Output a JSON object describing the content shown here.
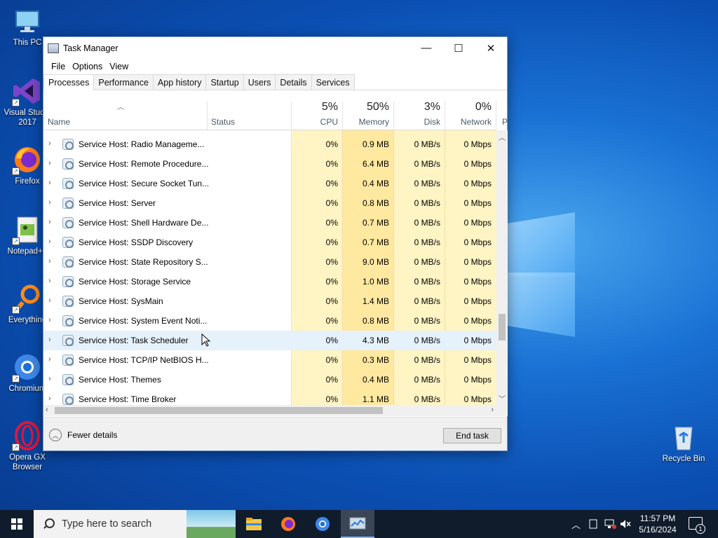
{
  "desktop": {
    "icons": [
      {
        "label": "This PC"
      },
      {
        "label": "Visual Studio 2017"
      },
      {
        "label": "Firefox"
      },
      {
        "label": "Notepad++"
      },
      {
        "label": "Everything"
      },
      {
        "label": "Chromium"
      },
      {
        "label": "Opera GX Browser"
      },
      {
        "label": "Recycle Bin"
      }
    ]
  },
  "window": {
    "title": "Task Manager",
    "menu": [
      "File",
      "Options",
      "View"
    ],
    "tabs": [
      "Processes",
      "Performance",
      "App history",
      "Startup",
      "Users",
      "Details",
      "Services"
    ],
    "active_tab": "Processes",
    "columns": {
      "name": "Name",
      "status": "Status",
      "cpu": {
        "pct": "5%",
        "label": "CPU"
      },
      "memory": {
        "pct": "50%",
        "label": "Memory"
      },
      "disk": {
        "pct": "3%",
        "label": "Disk"
      },
      "network": {
        "pct": "0%",
        "label": "Network"
      },
      "power": "P"
    },
    "rows": [
      {
        "name": "Service Host: Radio Manageme...",
        "cpu": "0%",
        "memory": "0.9 MB",
        "disk": "0 MB/s",
        "network": "0 Mbps"
      },
      {
        "name": "Service Host: Remote Procedure...",
        "cpu": "0%",
        "memory": "6.4 MB",
        "disk": "0 MB/s",
        "network": "0 Mbps"
      },
      {
        "name": "Service Host: Secure Socket Tun...",
        "cpu": "0%",
        "memory": "0.4 MB",
        "disk": "0 MB/s",
        "network": "0 Mbps"
      },
      {
        "name": "Service Host: Server",
        "cpu": "0%",
        "memory": "0.8 MB",
        "disk": "0 MB/s",
        "network": "0 Mbps"
      },
      {
        "name": "Service Host: Shell Hardware De...",
        "cpu": "0%",
        "memory": "0.7 MB",
        "disk": "0 MB/s",
        "network": "0 Mbps"
      },
      {
        "name": "Service Host: SSDP Discovery",
        "cpu": "0%",
        "memory": "0.7 MB",
        "disk": "0 MB/s",
        "network": "0 Mbps"
      },
      {
        "name": "Service Host: State Repository S...",
        "cpu": "0%",
        "memory": "9.0 MB",
        "disk": "0 MB/s",
        "network": "0 Mbps"
      },
      {
        "name": "Service Host: Storage Service",
        "cpu": "0%",
        "memory": "1.0 MB",
        "disk": "0 MB/s",
        "network": "0 Mbps"
      },
      {
        "name": "Service Host: SysMain",
        "cpu": "0%",
        "memory": "1.4 MB",
        "disk": "0 MB/s",
        "network": "0 Mbps"
      },
      {
        "name": "Service Host: System Event Noti...",
        "cpu": "0%",
        "memory": "0.8 MB",
        "disk": "0 MB/s",
        "network": "0 Mbps"
      },
      {
        "name": "Service Host: Task Scheduler",
        "cpu": "0%",
        "memory": "4.3 MB",
        "disk": "0 MB/s",
        "network": "0 Mbps"
      },
      {
        "name": "Service Host: TCP/IP NetBIOS H...",
        "cpu": "0%",
        "memory": "0.3 MB",
        "disk": "0 MB/s",
        "network": "0 Mbps"
      },
      {
        "name": "Service Host: Themes",
        "cpu": "0%",
        "memory": "0.4 MB",
        "disk": "0 MB/s",
        "network": "0 Mbps"
      },
      {
        "name": "Service Host: Time Broker",
        "cpu": "0%",
        "memory": "1.1 MB",
        "disk": "0 MB/s",
        "network": "0 Mbps"
      }
    ],
    "hovered_row": "Service Host: Task Scheduler",
    "footer": {
      "fewer_details": "Fewer details",
      "end_task": "End task"
    }
  },
  "taskbar": {
    "search_placeholder": "Type here to search",
    "time": "11:57 PM",
    "date": "5/16/2024",
    "notification_count": "1"
  },
  "colors": {
    "cpu_col": "#fff4c4",
    "memory_col": "#ffe8a0",
    "hover_row": "#e5f1fb",
    "taskbar": "#101c2c"
  }
}
